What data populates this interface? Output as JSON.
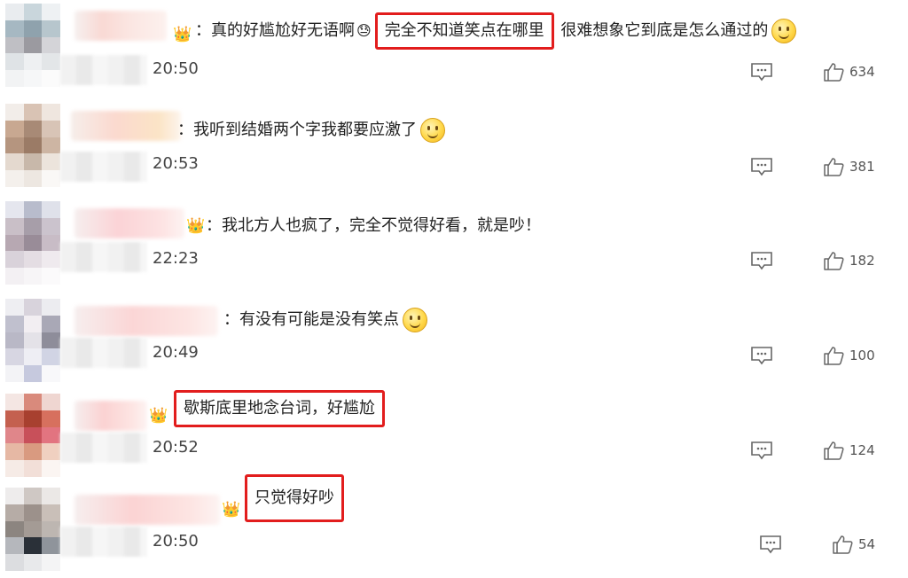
{
  "comments": [
    {
      "text_before": "：真的好尴尬好无语啊",
      "sad_emoji": "😓",
      "highlight": "完全不知道笑点在哪里",
      "text_after": "很难想象它到底是怎么通过的",
      "has_smile_emoji": true,
      "time": "20:50",
      "likes": "634",
      "avatar_colors": [
        "#e9ecef",
        "#c9d6dc",
        "#eef1f3",
        "#a6b8c2",
        "#8fa2ad",
        "#b7c6cd",
        "#bfbfc4",
        "#9b9aa0",
        "#d4d4d8",
        "#dfe3e6",
        "#eef0f2",
        "#e3e6e8",
        "#f2f3f4",
        "#f6f7f8",
        "#fbfbfb"
      ]
    },
    {
      "text_before": "：我听到结婚两个字我都要应激了",
      "sad_emoji": "",
      "highlight": "",
      "text_after": "",
      "has_smile_emoji": true,
      "time": "20:53",
      "likes": "381",
      "avatar_colors": [
        "#f2ede9",
        "#d9c3b4",
        "#efe6df",
        "#c8a891",
        "#a88a76",
        "#d8c4b6",
        "#b5957f",
        "#9b7b66",
        "#cdb5a3",
        "#e4d9cf",
        "#c8b8aa",
        "#ece4dc",
        "#f4f0ec",
        "#ede7e1",
        "#faf8f6"
      ]
    },
    {
      "text_before": "：我北方人也疯了，完全不觉得好看，就是吵！",
      "sad_emoji": "",
      "highlight": "",
      "text_after": "",
      "has_smile_emoji": false,
      "time": "22:23",
      "likes": "182",
      "avatar_colors": [
        "#e5e6ee",
        "#b8bccc",
        "#dfe1ea",
        "#c9bfc7",
        "#a79ea9",
        "#cbc3cd",
        "#b7a8b2",
        "#998c98",
        "#c8bcc6",
        "#d9d2da",
        "#e4dde3",
        "#efeaee",
        "#f3f0f3",
        "#f7f5f7",
        "#fbfafb"
      ]
    },
    {
      "text_before": "：有没有可能是没有笑点",
      "sad_emoji": "",
      "highlight": "",
      "text_after": "",
      "has_smile_emoji": true,
      "time": "20:49",
      "likes": "100",
      "avatar_colors": [
        "#eeeef2",
        "#d8d3dc",
        "#ececf0",
        "#c0c0ce",
        "#f2eef2",
        "#a9a8b6",
        "#b9b8c6",
        "#e4e2e8",
        "#8e8d9a",
        "#d7d6e2",
        "#eeeef4",
        "#d1d4e4",
        "#f3f3f6",
        "#c6c9de",
        "#f8f8fa"
      ]
    },
    {
      "text_before": "",
      "sad_emoji": "",
      "highlight": "歇斯底里地念台词，好尴尬",
      "text_after": "",
      "has_smile_emoji": false,
      "time": "20:52",
      "likes": "124",
      "avatar_colors": [
        "#f4e6e3",
        "#d98a7c",
        "#efd6d1",
        "#c4604f",
        "#a8402f",
        "#d7705e",
        "#e0868a",
        "#c8505a",
        "#e27480",
        "#e6b8a4",
        "#d99a80",
        "#f0d0c0",
        "#f6ebe6",
        "#f2dfd8",
        "#fbf5f2"
      ]
    },
    {
      "text_before": "",
      "sad_emoji": "",
      "highlight": "只觉得好吵",
      "text_after": "",
      "has_smile_emoji": false,
      "time": "20:50",
      "likes": "54",
      "avatar_colors": [
        "#eeecec",
        "#cfc8c4",
        "#ebe8e6",
        "#b6aca6",
        "#9c918b",
        "#c9bfb8",
        "#8c8580",
        "#a49b95",
        "#bdb6b1",
        "#b5b7bc",
        "#2a3038",
        "#8f949b",
        "#dcdde0",
        "#e8e9eb",
        "#f4f4f5"
      ]
    }
  ]
}
